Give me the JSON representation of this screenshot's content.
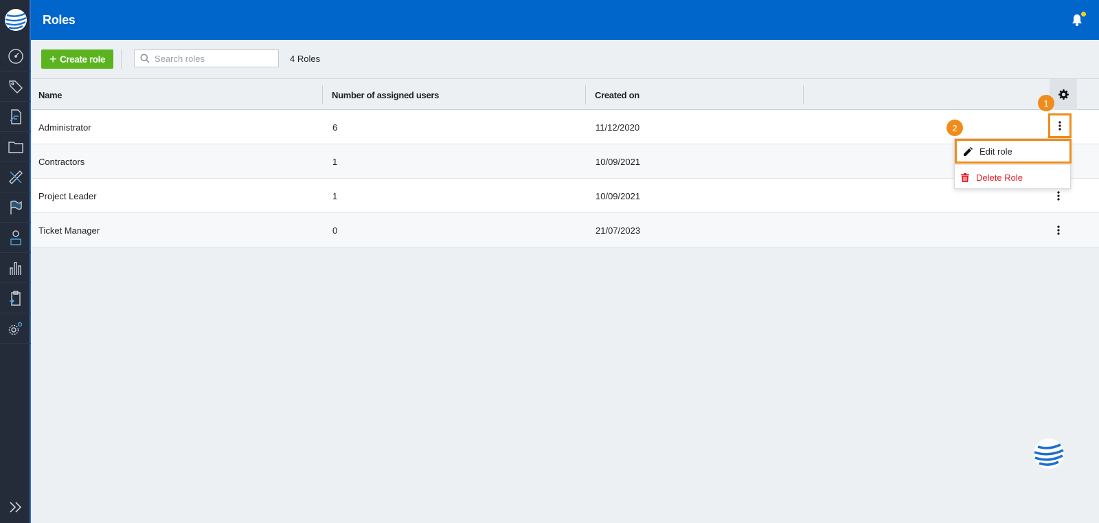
{
  "header": {
    "title": "Roles"
  },
  "sidebar": {
    "items": [
      {
        "icon": "speedometer-icon"
      },
      {
        "icon": "tags-icon"
      },
      {
        "icon": "document-edit-icon"
      },
      {
        "icon": "folder-icon"
      },
      {
        "icon": "ruler-pencil-icon"
      },
      {
        "icon": "flag-icon"
      },
      {
        "icon": "user-badge-icon"
      },
      {
        "icon": "bar-chart-icon"
      },
      {
        "icon": "clipboard-icon"
      },
      {
        "icon": "settings-gears-icon"
      }
    ]
  },
  "toolbar": {
    "create_label": "Create role",
    "search_placeholder": "Search roles",
    "count_text": "4 Roles"
  },
  "table": {
    "columns": [
      "Name",
      "Number of assigned users",
      "Created on"
    ],
    "rows": [
      {
        "name": "Administrator",
        "users": "6",
        "created": "11/12/2020"
      },
      {
        "name": "Contractors",
        "users": "1",
        "created": "10/09/2021"
      },
      {
        "name": "Project Leader",
        "users": "1",
        "created": "10/09/2021"
      },
      {
        "name": "Ticket Manager",
        "users": "0",
        "created": "21/07/2023"
      }
    ]
  },
  "menu": {
    "edit_label": "Edit role",
    "delete_label": "Delete Role"
  },
  "callouts": {
    "one": "1",
    "two": "2"
  },
  "colors": {
    "header_blue": "#0066cc",
    "sidebar_dark": "#232c38",
    "create_green": "#5ab31f",
    "highlight_orange": "#f08c1a",
    "delete_red": "#e01b24",
    "notification_dot": "#f4d21a"
  }
}
